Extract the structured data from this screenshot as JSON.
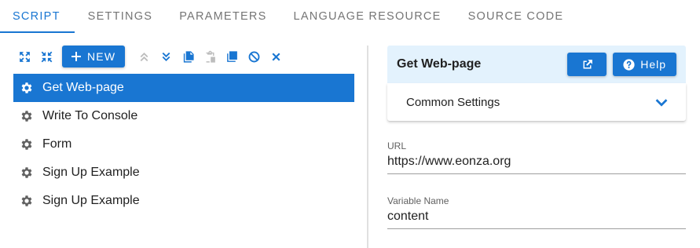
{
  "tabs": [
    {
      "label": "SCRIPT",
      "active": true
    },
    {
      "label": "SETTINGS",
      "active": false
    },
    {
      "label": "PARAMETERS",
      "active": false
    },
    {
      "label": "LANGUAGE RESOURCE",
      "active": false
    },
    {
      "label": "SOURCE CODE",
      "active": false
    }
  ],
  "toolbar": {
    "new_label": "NEW",
    "icons": [
      "expand-all-icon",
      "collapse-all-icon",
      "add-icon",
      "move-up-icon",
      "move-down-icon",
      "copy-icon",
      "paste-icon",
      "duplicate-icon",
      "disable-icon",
      "delete-icon"
    ]
  },
  "scripts": [
    {
      "label": "Get Web-page",
      "selected": true
    },
    {
      "label": "Write To Console",
      "selected": false
    },
    {
      "label": "Form",
      "selected": false
    },
    {
      "label": "Sign Up Example",
      "selected": false
    },
    {
      "label": "Sign Up Example",
      "selected": false
    }
  ],
  "panel": {
    "title": "Get Web-page",
    "help_label": "Help",
    "section_label": "Common Settings",
    "fields": {
      "url": {
        "label": "URL",
        "value": "https://www.eonza.org"
      },
      "var": {
        "label": "Variable Name",
        "value": "content"
      }
    }
  },
  "colors": {
    "accent": "#1976d2",
    "header_bg": "#e3f2fd",
    "muted": "#757575",
    "disabled": "#bdbdbd"
  }
}
